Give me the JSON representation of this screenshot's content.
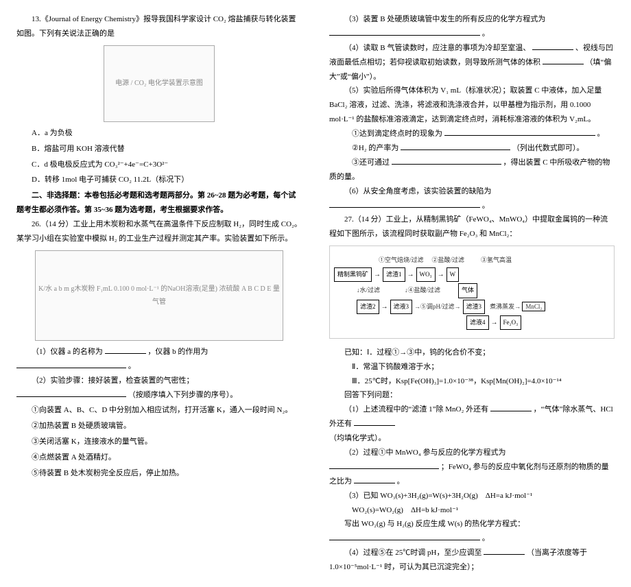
{
  "left": {
    "q13": {
      "stem": "13.《Journal of Energy Chemistry》报导我国科学家设计 CO₂ 熔盐捕获与转化装置如图。下列有关说法正确的是",
      "img_label": "电源 / CO₂ 电化学装置示意图",
      "optA": "A．a 为负极",
      "optB": "B．熔盐可用 KOH 溶液代替",
      "optC": "C．d 极电极反应式为 CO₃²⁻+4e⁻=C+3O²⁻",
      "optD": "D．转移 1mol 电子可捕获 CO₂ 11.2L（标况下）"
    },
    "section2": "二、非选择题：本卷包括必考题和选考题两部分。第 26~28 题为必考题，每个试题考生都必须作答。第 35~36 题为选考题，考生根据要求作答。",
    "q26": {
      "stem": "26.（14 分）工业上用木炭粉和水蒸气在高温条件下反应制取 H₂，同时生成 CO₂。某学习小组在实验室中模拟 H₂ 的工业生产过程并测定其产率。实验装置如下所示。",
      "img_label": "K/水  a  b  m g木炭粉  F₁mL 0.100 0 mol·L⁻¹ 的NaOH溶液(足量)  浓硫酸  A B C D E  量气管",
      "p1a": "（1）仪器 a 的名称为",
      "p1b": "，仪器 b 的作用为",
      "p1c": "。",
      "p2a": "（2）实验步骤：接好装置，检查装置的气密性；",
      "p2b": "（按顺序填入下列步骤的序号）。",
      "s1": "①向装置 A、B、C、D 中分别加入相应试剂，打开活塞 K，通入一段时间 N₂。",
      "s2": "②加热装置 B 处硬质玻璃管。",
      "s3": "③关闭活塞 K，连接液水的量气管。",
      "s4": "④点燃装置 A 处酒精灯。",
      "s5": "⑤待装置 B 处木炭粉完全反应后，停止加热。"
    }
  },
  "right": {
    "p3a": "（3）装置 B 处硬质玻璃管中发生的所有反应的化学方程式为",
    "p3b": "。",
    "p4a": "（4）读取 B 气管读数时，应注意的事项为冷却至室温、",
    "p4b": "、视线与凹液面最低点相切；若仰视读取初始读数，则导致所测气体的体积",
    "p4c": "（填“偏大”或“偏小”）。",
    "p5": "（5）实验后所得气体体积为 V₁ mL（标准状况）；取装置 C 中液体，加入足量 BaCl₂ 溶液，过滤、洗涤，将滤液和洗涤液合并，以甲基橙为指示剂，用 0.1000 mol·L⁻¹ 的盐酸标准溶液滴定，达到滴定终点时，消耗标准溶液的体积为 V₂mL。",
    "p5_1a": "①达到滴定终点时的现象为",
    "p5_1b": "。",
    "p5_2a": "②H₂ 的产率为",
    "p5_2b": "（列出代数式即可）。",
    "p5_3a": "③还可通过",
    "p5_3b": "，得出装置 C 中所吸收产物的物质的量。",
    "p6a": "（6）从安全角度考虑，该实验装置的缺陷为",
    "p6b": "。",
    "q27": {
      "stem": "27.（14 分）工业上，从精制黑钨矿（FeWO₄、MnWO₄）中提取金属钨的一种流程如下图所示，该流程同时获取副产物 Fe₂O₃ 和 MnCl₂：",
      "flow": {
        "start": "精制黑钨矿",
        "top1": "①空气焙烧/过滤",
        "res1": "滤渣1",
        "top2": "②盐酸/过滤",
        "res2": "WO₃",
        "top3": "③氢气高温",
        "w": "W",
        "bot1": "水/过滤",
        "res3": "滤渣2",
        "bot2": "④盐酸/过滤",
        "res4": "滤液3",
        "gas": "气体",
        "bot3": "⑤调pH/过滤",
        "res5": "滤渣3",
        "boil": "煮沸蒸发",
        "mncl2": "MnCl₂",
        "filtr4": "滤液4",
        "fe2o3": "Fe₂O₃"
      },
      "known_head": "已知：Ⅰ．过程①→③中，钨的化合价不变；",
      "known2": "Ⅱ．常温下钨酸难溶于水；",
      "known3": "Ⅲ．25℃时，Ksp[Fe(OH)₃]=1.0×10⁻³⁸，Ksp[Mn(OH)₂]=4.0×10⁻¹⁴",
      "ans_head": "回答下列问题：",
      "a1a": "（1）上述流程中的“滤渣 1”除 MnO₂ 外还有",
      "a1b": "，“气体”除水蒸气、HCl 外还有",
      "a1c": "（均填化学式）。",
      "a2a": "（2）过程①中 MnWO₄ 参与反应的化学方程式为",
      "a2b": "；FeWO₄ 参与的反应中氧化剂与还原剂的物质的量之比为",
      "a2c": "。",
      "a3_h": "（3）已知 WO₃(s)+3H₂(g)=W(s)+3H₂O(g)　ΔH=a kJ·mol⁻¹",
      "a3_l2": "WO₂(s)=WO₂(g)　ΔH=b kJ·mol⁻¹",
      "a3_qa": "写出 WO₂(g) 与 H₂(g) 反应生成 W(s) 的热化学方程式：",
      "a3_qb": "。",
      "a4a": "（4）过程⑤在 25℃时调 pH，至少应调至",
      "a4b": "（当离子浓度等于 1.0×10⁻⁵mol·L⁻¹ 时，可认为其已沉淀完全）；"
    }
  }
}
